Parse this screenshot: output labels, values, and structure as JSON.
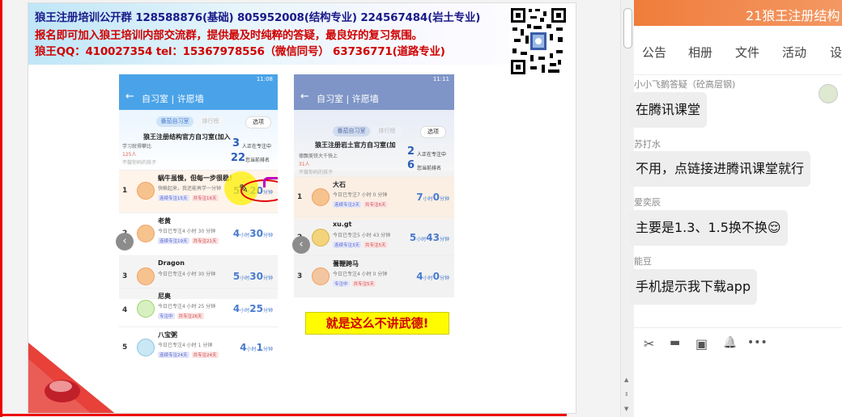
{
  "slide": {
    "banner": {
      "line1": "狼王注册培训公开群 128588876(基础) 805952008(结构专业) 224567484(岩土专业)",
      "line2": "报名即可加入狼王培训内部交流群，提供最及时纯粹的答疑，最良好的复习氛围。",
      "line3": "狼王QQ：410027354   tel：15367978556（微信同号）   63736771(道路专业)"
    },
    "phone1": {
      "status_time": "11:08",
      "title": "自习室 | 许愿墙",
      "tab_active": "番茄自习室",
      "tab_inactive": "排行榜",
      "options": "选项",
      "room_title": "狼王注册结构官方自习室(加入",
      "label_left1": "学习就得攀比",
      "label_left2": "125人",
      "label_left3": "不做你妈的孩子",
      "stat1_num": "3",
      "stat1_label": "人正在专注中",
      "stat2_num": "22",
      "stat2_label": "您当前排名",
      "rows": [
        {
          "rank": "1",
          "name": "蜗牛虽慢，但每一步很稳！",
          "sub": "快瞅起来，我还能再学一分钟",
          "tag1": "连续专注15天",
          "tag2": "共专注16天",
          "h": "5",
          "m": "20"
        },
        {
          "rank": "2",
          "name": "老黄",
          "sub": "今日已专注4 小时 30 分钟",
          "tag1": "连续专注19天",
          "tag2": "共专注21天",
          "h": "4",
          "m": "30"
        },
        {
          "rank": "3",
          "name": "Dragon",
          "sub": "今日已专注4 小时 30 分钟",
          "tag1": "",
          "tag2": "",
          "h": "5",
          "m": "30"
        },
        {
          "rank": "4",
          "name": "尼奥",
          "sub": "今日已专注4 小时 25 分钟",
          "tag1": "专注中",
          "tag2": "共专注26天",
          "h": "4",
          "m": "25"
        },
        {
          "rank": "5",
          "name": "八宝粥",
          "sub": "今日已专注4 小时 1 分钟",
          "tag1": "连续专注24天",
          "tag2": "共专注24天",
          "h": "4",
          "m": "1"
        }
      ]
    },
    "phone2": {
      "status_time": "11:11",
      "title": "自习室 | 许愿墙",
      "tab_active": "番茄自习室",
      "tab_inactive": "排行榜",
      "options": "选项",
      "room_title": "狼王注册岩土官方自习室(加",
      "label_left1": "德飘美铁大千快上",
      "label_left2": "31人",
      "label_left3": "不做你妈的孩子",
      "stat1_num": "2",
      "stat1_label": "人正在专注中",
      "stat2_num": "6",
      "stat2_label": "您当前排名",
      "rows": [
        {
          "rank": "1",
          "name": "大石",
          "sub": "今日已专注7 小时 0 分钟",
          "tag1": "连续专注2天",
          "tag2": "共专注6天",
          "h": "7",
          "m": "0"
        },
        {
          "rank": "2",
          "name": "xu.gt",
          "sub": "今日已专注5 小时 43 分钟",
          "tag1": "连续专注3天",
          "tag2": "共专注5天",
          "h": "5",
          "m": "43"
        },
        {
          "rank": "3",
          "name": "蓍鞭跨马",
          "sub": "今日已专注4 小时 0 分钟",
          "tag1": "专注中",
          "tag2": "共专注5天",
          "h": "4",
          "m": "0"
        }
      ]
    },
    "time_units": {
      "h": "小时",
      "m": "分钟"
    },
    "caption": "就是这么不讲武德!"
  },
  "chat": {
    "header_title": "21狼王注册结构",
    "tabs": [
      "公告",
      "相册",
      "文件",
      "活动",
      "设"
    ],
    "messages": [
      {
        "name": "小小飞鹅答疑（砼高层钢)",
        "text": "在腾讯课堂"
      },
      {
        "name": "苏打水",
        "text": "不用，点链接进腾讯课堂就行"
      },
      {
        "name": "爱奕辰",
        "text": "主要是1.3、1.5换不换😌"
      },
      {
        "name": "能豆",
        "text": "手机提示我下载app"
      }
    ],
    "toolbar_icons": [
      "scissors-icon",
      "folder-icon",
      "image-icon",
      "bell-icon",
      "more-icon"
    ],
    "toolbar_glyphs": {
      "scissors": "✂",
      "folder": "▬",
      "image": "▣",
      "bell": "🔔",
      "more": "•••"
    }
  },
  "colors": {
    "accent_orange": "#f07c3b",
    "phone_blue": "#4aa3e8",
    "banner_red": "#d00000",
    "banner_navy": "#1a1a8a"
  }
}
